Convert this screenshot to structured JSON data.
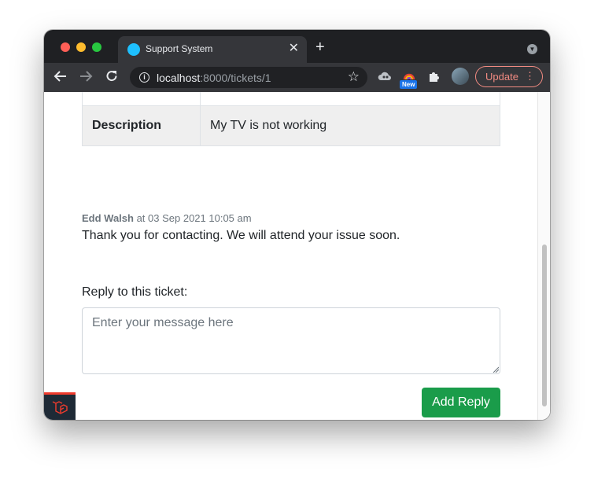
{
  "browser": {
    "tab": {
      "title": "Support System",
      "favicon_color": "#1ec0ff"
    },
    "new_tab_glyph": "+",
    "close_glyph": "✕",
    "url": {
      "host": "localhost",
      "path": ":8000/tickets/1"
    },
    "extension_badge": "New",
    "update_label": "Update",
    "icons": [
      "back-arrow-icon",
      "forward-arrow-icon",
      "reload-icon",
      "info-icon",
      "star-icon",
      "cloud-extension-icon",
      "color-extension-icon",
      "puzzle-icon",
      "avatar",
      "kebab-menu-icon",
      "tab-menu-icon"
    ]
  },
  "ticket": {
    "description_label": "Description",
    "description_value": "My TV is not working"
  },
  "comment": {
    "author": "Edd Walsh",
    "timestamp": " at 03 Sep 2021 10:05 am",
    "body": "Thank you for contacting. We will attend your issue soon."
  },
  "reply": {
    "label": "Reply to this ticket:",
    "placeholder": "Enter your message here",
    "button_label": "Add Reply"
  },
  "colors": {
    "titlebar": "#1f2023",
    "toolbar": "#35363a",
    "accent_green": "#1a9c4a",
    "update_red": "#f28b82",
    "laravel_red": "#ef3b2d"
  }
}
